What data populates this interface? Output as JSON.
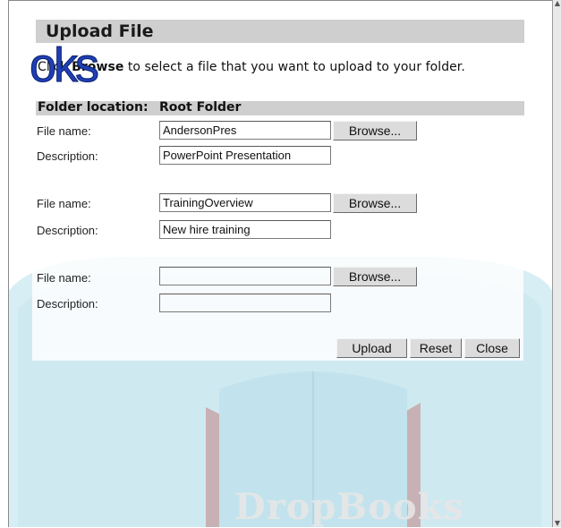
{
  "dialog": {
    "title": "Upload File",
    "instruction_pre": "Click ",
    "instruction_bold": "Browse",
    "instruction_post": " to select a file that you want to upload to your folder.",
    "watermark_overlay": "oks",
    "folder_location_label": "Folder location:",
    "folder_location_value": "Root Folder"
  },
  "rows": [
    {
      "file_label": "File name:",
      "file_value": "AndersonPres",
      "desc_label": "Description:",
      "desc_value": "PowerPoint Presentation",
      "browse_label": "Browse..."
    },
    {
      "file_label": "File name:",
      "file_value": "TrainingOverview",
      "desc_label": "Description:",
      "desc_value": "New hire training",
      "browse_label": "Browse..."
    },
    {
      "file_label": "File name:",
      "file_value": "",
      "desc_label": "Description:",
      "desc_value": "",
      "browse_label": "Browse..."
    }
  ],
  "actions": {
    "upload": "Upload",
    "reset": "Reset",
    "close": "Close"
  },
  "background": {
    "watermark_text": "DropBooks",
    "colors": {
      "teal": "#d6eff5",
      "teal_dark": "#bfe4ee",
      "book_red": "#c98a8a",
      "panel_gray": "#cfcfcf",
      "overlay_blue": "#1f3fb5"
    }
  }
}
